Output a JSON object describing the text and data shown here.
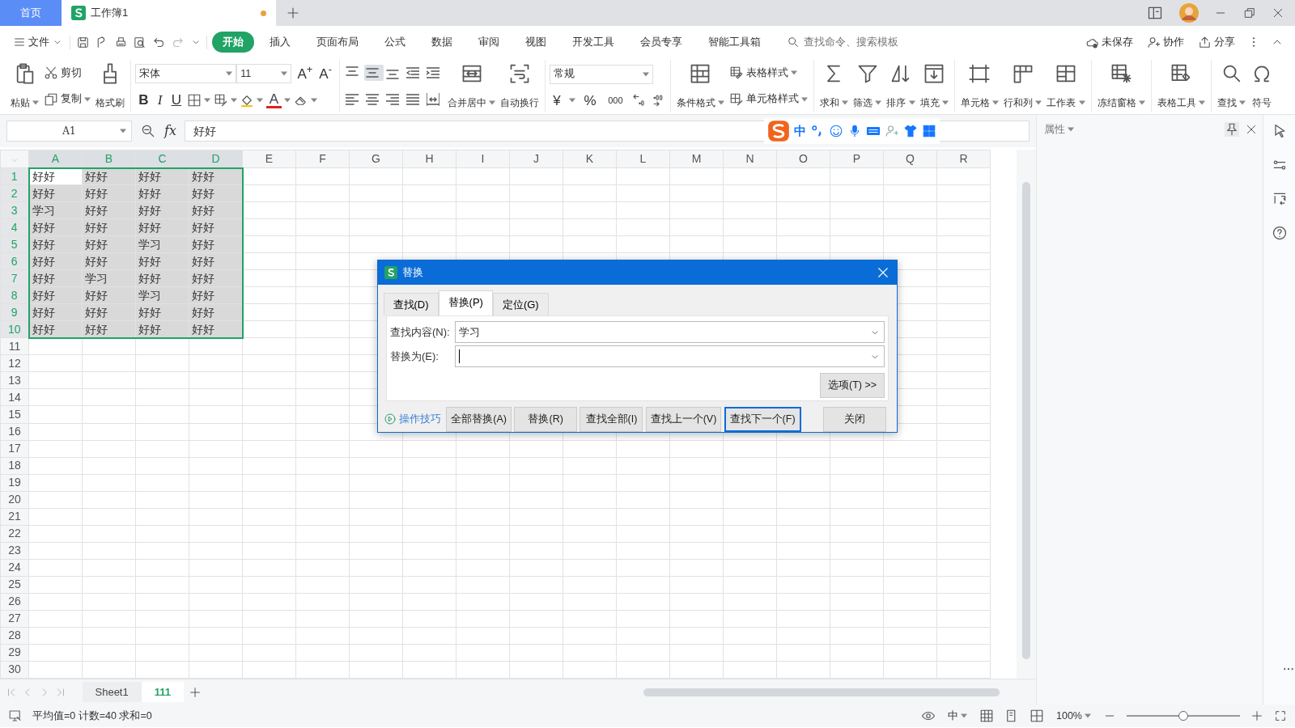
{
  "app_tabs": [
    {
      "label": "首页",
      "kind": "home",
      "selected": false,
      "unsaved": false
    },
    {
      "label": "工作簿1",
      "kind": "doc",
      "selected": true,
      "unsaved": true
    }
  ],
  "file_menu": "文件",
  "ribbon_tabs": [
    {
      "label": "开始",
      "selected": true
    },
    {
      "label": "插入",
      "selected": false
    },
    {
      "label": "页面布局",
      "selected": false
    },
    {
      "label": "公式",
      "selected": false
    },
    {
      "label": "数据",
      "selected": false
    },
    {
      "label": "审阅",
      "selected": false
    },
    {
      "label": "视图",
      "selected": false
    },
    {
      "label": "开发工具",
      "selected": false
    },
    {
      "label": "会员专享",
      "selected": false
    },
    {
      "label": "智能工具箱",
      "selected": false
    }
  ],
  "command_search": {
    "placeholder": "查找命令、搜索模板"
  },
  "actions": [
    "未保存",
    "协作",
    "分享"
  ],
  "ribbon_groups": [
    {
      "items": [
        {
          "kind": "large",
          "label": "粘贴",
          "dropdown": true
        },
        {
          "kind": "stack",
          "items": [
            {
              "label": "剪切",
              "dropdown": false
            },
            {
              "label": "复制",
              "dropdown": true
            }
          ]
        },
        {
          "kind": "large",
          "label": "格式刷",
          "dropdown": false
        }
      ]
    },
    {
      "items": [
        {
          "kind": "font",
          "font_name": "宋体",
          "font_size": "11",
          "grow": "A$^{+}$",
          "shrink": "A$^{-}$",
          "bold": "B",
          "italic": "I",
          "underline": "U",
          "color_letter": "A"
        }
      ]
    },
    {
      "items": [
        {
          "kind": "align",
          "buttons": [
            {
              "selected": false
            },
            {
              "selected": true
            },
            {
              "selected": false
            },
            {
              "selected": false
            },
            {
              "selected": false
            },
            {
              "selected": false
            },
            {
              "selected": false
            },
            {
              "selected": false
            },
            {
              "selected": false
            },
            {
              "selected": false
            }
          ]
        },
        {
          "kind": "large",
          "label": "合并居中",
          "dropdown": true
        },
        {
          "kind": "large",
          "label": "自动换行",
          "dropdown": false
        }
      ]
    },
    {
      "items": [
        {
          "kind": "number",
          "format": "常规",
          "currency": "¥",
          "percent": "%",
          "thousands": "000"
        }
      ]
    },
    {
      "items": [
        {
          "kind": "large",
          "label": "条件格式",
          "dropdown": true
        },
        {
          "kind": "stack",
          "items": [
            {
              "label": "表格样式",
              "dropdown": true
            },
            {
              "label": "单元格样式",
              "dropdown": true
            }
          ]
        }
      ]
    },
    {
      "items": [
        {
          "kind": "large",
          "label": "求和",
          "dropdown": true
        },
        {
          "kind": "large",
          "label": "筛选",
          "dropdown": true
        },
        {
          "kind": "large",
          "label": "排序",
          "dropdown": true
        },
        {
          "kind": "large",
          "label": "填充",
          "dropdown": true
        }
      ]
    },
    {
      "items": [
        {
          "kind": "large",
          "label": "单元格",
          "dropdown": true
        },
        {
          "kind": "large",
          "label": "行和列",
          "dropdown": true
        },
        {
          "kind": "large",
          "label": "工作表",
          "dropdown": true
        }
      ]
    },
    {
      "items": [
        {
          "kind": "large",
          "label": "冻结窗格",
          "dropdown": true
        }
      ]
    },
    {
      "items": [
        {
          "kind": "large",
          "label": "表格工具",
          "dropdown": true
        }
      ]
    },
    {
      "items": [
        {
          "kind": "large",
          "label": "查找",
          "dropdown": true
        },
        {
          "kind": "large",
          "label": "符号",
          "dropdown": false
        }
      ]
    }
  ],
  "name_box": "A1",
  "fx_label": "fx",
  "formula": "好好",
  "ime_toolbar": {
    "mode": "中"
  },
  "properties_panel": {
    "title": "属性"
  },
  "grid": {
    "columns": [
      {
        "label": "A",
        "selected": true
      },
      {
        "label": "B",
        "selected": true
      },
      {
        "label": "C",
        "selected": true
      },
      {
        "label": "D",
        "selected": true
      },
      {
        "label": "E",
        "selected": false
      },
      {
        "label": "F",
        "selected": false
      },
      {
        "label": "G",
        "selected": false
      },
      {
        "label": "H",
        "selected": false
      },
      {
        "label": "I",
        "selected": false
      },
      {
        "label": "J",
        "selected": false
      },
      {
        "label": "K",
        "selected": false
      },
      {
        "label": "L",
        "selected": false
      },
      {
        "label": "M",
        "selected": false
      },
      {
        "label": "N",
        "selected": false
      },
      {
        "label": "O",
        "selected": false
      },
      {
        "label": "P",
        "selected": false
      },
      {
        "label": "Q",
        "selected": false
      },
      {
        "label": "R",
        "selected": false
      }
    ],
    "rows": [
      {
        "label": "1",
        "selected": true,
        "cells": [
          {
            "text": "好好",
            "selected": false
          },
          {
            "text": "好好",
            "selected": true
          },
          {
            "text": "好好",
            "selected": true
          },
          {
            "text": "好好",
            "selected": true
          }
        ]
      },
      {
        "label": "2",
        "selected": true,
        "cells": [
          {
            "text": "好好",
            "selected": true
          },
          {
            "text": "好好",
            "selected": true
          },
          {
            "text": "好好",
            "selected": true
          },
          {
            "text": "好好",
            "selected": true
          }
        ]
      },
      {
        "label": "3",
        "selected": true,
        "cells": [
          {
            "text": "学习",
            "selected": true
          },
          {
            "text": "好好",
            "selected": true
          },
          {
            "text": "好好",
            "selected": true
          },
          {
            "text": "好好",
            "selected": true
          }
        ]
      },
      {
        "label": "4",
        "selected": true,
        "cells": [
          {
            "text": "好好",
            "selected": true
          },
          {
            "text": "好好",
            "selected": true
          },
          {
            "text": "好好",
            "selected": true
          },
          {
            "text": "好好",
            "selected": true
          }
        ]
      },
      {
        "label": "5",
        "selected": true,
        "cells": [
          {
            "text": "好好",
            "selected": true
          },
          {
            "text": "好好",
            "selected": true
          },
          {
            "text": "学习",
            "selected": true
          },
          {
            "text": "好好",
            "selected": true
          }
        ]
      },
      {
        "label": "6",
        "selected": true,
        "cells": [
          {
            "text": "好好",
            "selected": true
          },
          {
            "text": "好好",
            "selected": true
          },
          {
            "text": "好好",
            "selected": true
          },
          {
            "text": "好好",
            "selected": true
          }
        ]
      },
      {
        "label": "7",
        "selected": true,
        "cells": [
          {
            "text": "好好",
            "selected": true
          },
          {
            "text": "学习",
            "selected": true
          },
          {
            "text": "好好",
            "selected": true
          },
          {
            "text": "好好",
            "selected": true
          }
        ]
      },
      {
        "label": "8",
        "selected": true,
        "cells": [
          {
            "text": "好好",
            "selected": true
          },
          {
            "text": "好好",
            "selected": true
          },
          {
            "text": "学习",
            "selected": true
          },
          {
            "text": "好好",
            "selected": true
          }
        ]
      },
      {
        "label": "9",
        "selected": true,
        "cells": [
          {
            "text": "好好",
            "selected": true
          },
          {
            "text": "好好",
            "selected": true
          },
          {
            "text": "好好",
            "selected": true
          },
          {
            "text": "好好",
            "selected": true
          }
        ]
      },
      {
        "label": "10",
        "selected": true,
        "cells": [
          {
            "text": "好好",
            "selected": true
          },
          {
            "text": "好好",
            "selected": true
          },
          {
            "text": "好好",
            "selected": true
          },
          {
            "text": "好好",
            "selected": true
          }
        ]
      },
      {
        "label": "11",
        "selected": false
      },
      {
        "label": "12",
        "selected": false
      },
      {
        "label": "13",
        "selected": false
      },
      {
        "label": "14",
        "selected": false
      },
      {
        "label": "15",
        "selected": false
      },
      {
        "label": "16",
        "selected": false
      },
      {
        "label": "17",
        "selected": false
      },
      {
        "label": "18",
        "selected": false
      },
      {
        "label": "19",
        "selected": false
      },
      {
        "label": "20",
        "selected": false
      },
      {
        "label": "21",
        "selected": false
      },
      {
        "label": "22",
        "selected": false
      },
      {
        "label": "23",
        "selected": false
      },
      {
        "label": "24",
        "selected": false
      },
      {
        "label": "25",
        "selected": false
      },
      {
        "label": "26",
        "selected": false
      },
      {
        "label": "27",
        "selected": false
      },
      {
        "label": "28",
        "selected": false
      },
      {
        "label": "29",
        "selected": false
      },
      {
        "label": "30",
        "selected": false
      }
    ]
  },
  "sheet_tabs": [
    {
      "label": "Sheet1",
      "selected": false
    },
    {
      "label": "111",
      "selected": true
    }
  ],
  "dialog": {
    "title": "替换",
    "tabs": [
      {
        "label": "查找(D)",
        "selected": false
      },
      {
        "label": "替换(P)",
        "selected": true
      },
      {
        "label": "定位(G)",
        "selected": false
      }
    ],
    "find_field": {
      "label": "查找内容(N):",
      "value": "学习",
      "focused": false
    },
    "replace_field": {
      "label": "替换为(E):",
      "focused": true
    },
    "options_button": "选项(T) >>",
    "tips_link": "操作技巧",
    "buttons": [
      {
        "label": "全部替换(A)",
        "default": false
      },
      {
        "label": "替换(R)",
        "default": false
      },
      {
        "label": "查找全部(I)",
        "default": false
      },
      {
        "label": "查找上一个(V)",
        "default": false
      },
      {
        "label": "查找下一个(F)",
        "default": true
      },
      {
        "label": "关闭",
        "default": false
      }
    ]
  },
  "status_bar": {
    "summary": "平均值=0 计数=40 求和=0",
    "input_mode": "中",
    "zoom": "100%",
    "zoom_slider": {
      "level": 0.5
    }
  }
}
